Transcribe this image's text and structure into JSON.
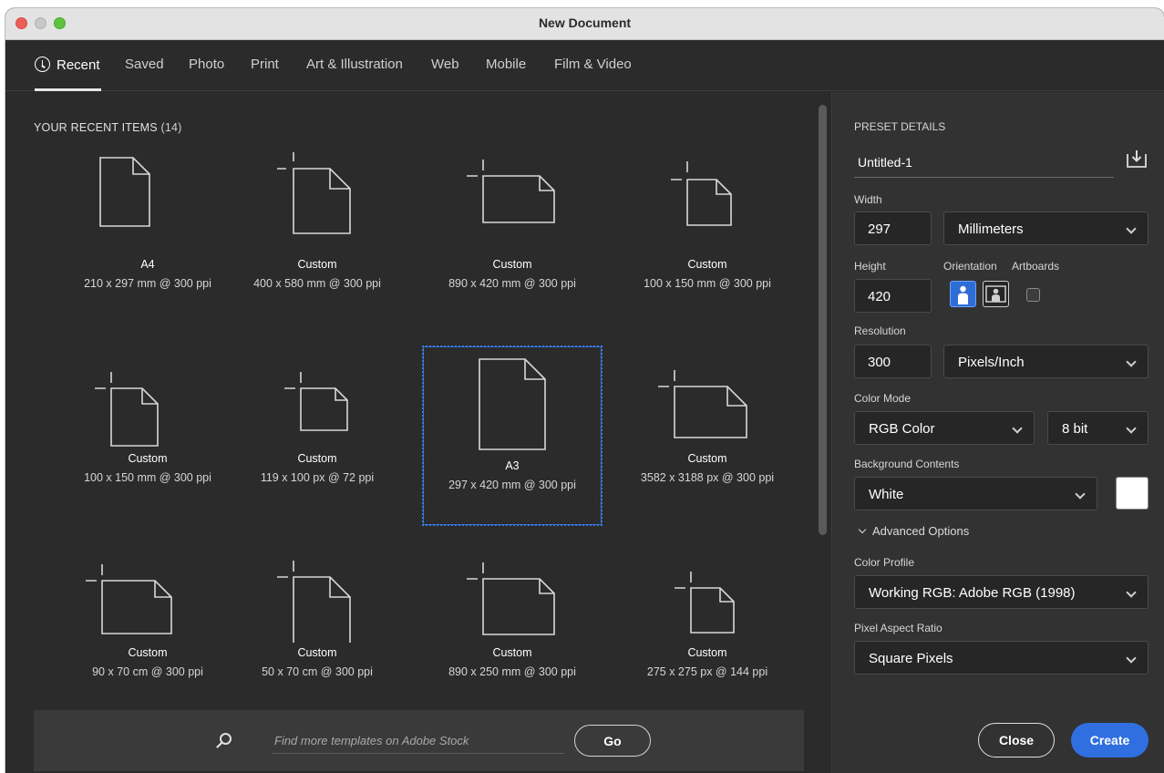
{
  "window": {
    "title": "New Document"
  },
  "tabs": [
    {
      "label": "Recent",
      "icon": "clock-icon"
    },
    {
      "label": "Saved"
    },
    {
      "label": "Photo"
    },
    {
      "label": "Print"
    },
    {
      "label": "Art & Illustration"
    },
    {
      "label": "Web"
    },
    {
      "label": "Mobile"
    },
    {
      "label": "Film & Video"
    }
  ],
  "recent": {
    "title": "YOUR RECENT ITEMS",
    "count": "(14)",
    "items": [
      {
        "name": "A4",
        "dims": "210 x 297 mm @ 300 ppi"
      },
      {
        "name": "Custom",
        "dims": "400 x 580 mm @ 300 ppi"
      },
      {
        "name": "Custom",
        "dims": "890 x 420 mm @ 300 ppi"
      },
      {
        "name": "Custom",
        "dims": "100 x 150 mm @ 300 ppi"
      },
      {
        "name": "Custom",
        "dims": "100 x 150 mm @ 300 ppi"
      },
      {
        "name": "Custom",
        "dims": "119 x 100 px @ 72 ppi"
      },
      {
        "name": "A3",
        "dims": "297 x 420 mm @ 300 ppi"
      },
      {
        "name": "Custom",
        "dims": "3582 x 3188 px @ 300 ppi"
      },
      {
        "name": "Custom",
        "dims": "90 x 70 cm @ 300 ppi"
      },
      {
        "name": "Custom",
        "dims": "50 x 70 cm @ 300 ppi"
      },
      {
        "name": "Custom",
        "dims": "890 x 250 mm @ 300 ppi"
      },
      {
        "name": "Custom",
        "dims": "275 x 275 px @ 144 ppi"
      }
    ]
  },
  "search": {
    "placeholder": "Find more templates on Adobe Stock",
    "go_label": "Go"
  },
  "preset": {
    "header": "PRESET DETAILS",
    "name": "Untitled-1",
    "width_label": "Width",
    "width": "297",
    "width_unit": "Millimeters",
    "height_label": "Height",
    "height": "420",
    "orientation_label": "Orientation",
    "artboards_label": "Artboards",
    "resolution_label": "Resolution",
    "resolution": "300",
    "resolution_unit": "Pixels/Inch",
    "color_mode_label": "Color Mode",
    "color_mode": "RGB Color",
    "bit_depth": "8 bit",
    "background_label": "Background Contents",
    "background": "White",
    "advanced_label": "Advanced Options",
    "color_profile_label": "Color Profile",
    "color_profile": "Working RGB: Adobe RGB (1998)",
    "pixel_aspect_label": "Pixel Aspect Ratio",
    "pixel_aspect": "Square Pixels",
    "close_label": "Close",
    "create_label": "Create"
  },
  "colors": {
    "accent": "#2f6fe0",
    "panel": "#323232",
    "background": "#2b2b2b"
  }
}
